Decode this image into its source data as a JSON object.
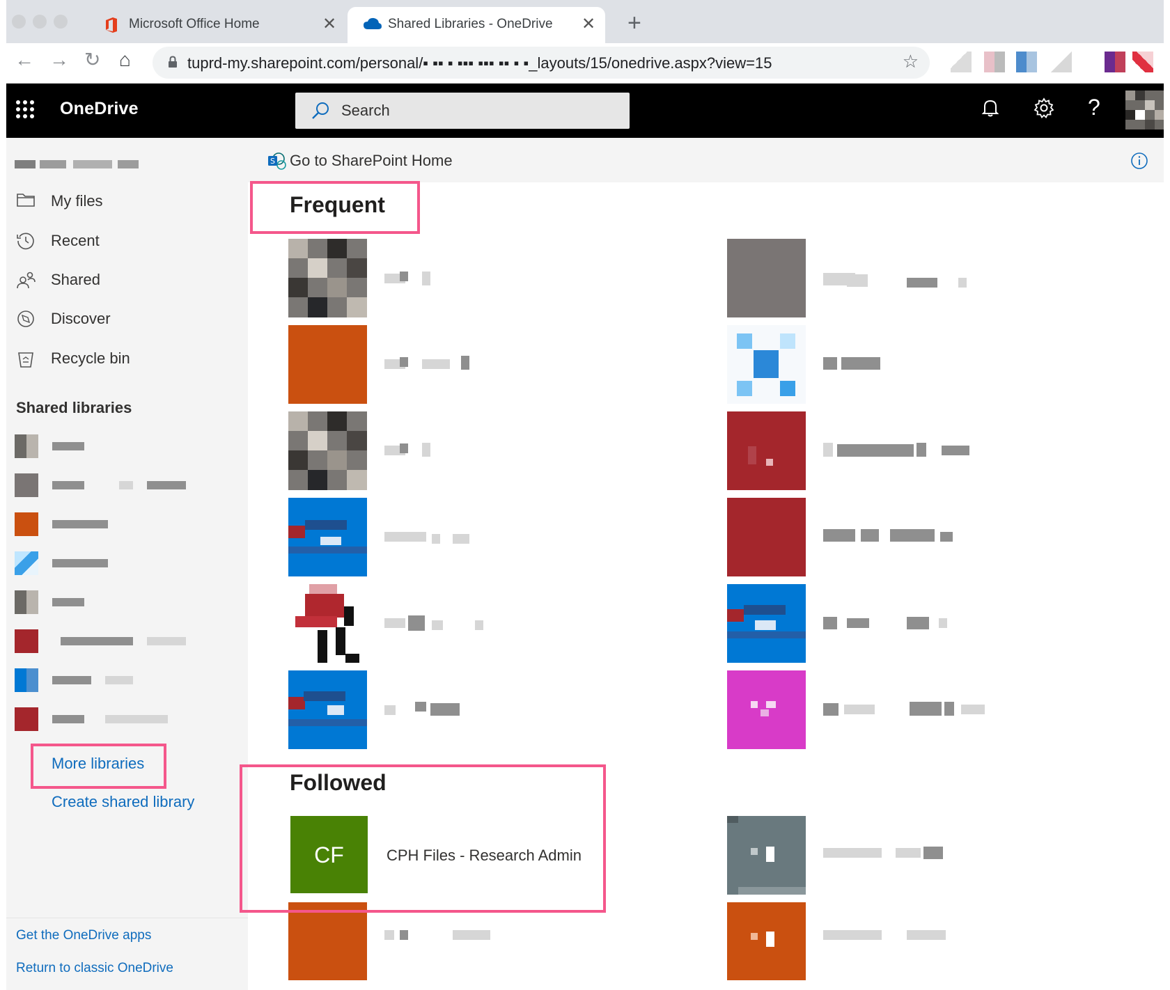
{
  "browser": {
    "tabs": [
      {
        "label": "Microsoft Office Home",
        "active": false,
        "icon": "office-icon"
      },
      {
        "label": "Shared Libraries - OneDrive",
        "active": true,
        "icon": "onedrive-cloud-icon"
      }
    ],
    "close_glyph": "✕",
    "new_tab_glyph": "+",
    "url": "tuprd-my.sharepoint.com/personal/▪ ▪▪ ▪ ▪▪▪ ▪▪▪ ▪▪ ▪ ▪_layouts/15/onedrive.aspx?view=15",
    "back_glyph": "←",
    "forward_glyph": "→",
    "reload_glyph": "↻",
    "home_glyph": "⌂",
    "star_glyph": "☆"
  },
  "header": {
    "app_name": "OneDrive",
    "search_placeholder": "Search",
    "help_glyph": "?"
  },
  "nav": {
    "items": [
      {
        "label": "My files",
        "icon": "folder-icon"
      },
      {
        "label": "Recent",
        "icon": "recent-clock-icon"
      },
      {
        "label": "Shared",
        "icon": "shared-people-icon"
      },
      {
        "label": "Discover",
        "icon": "discover-compass-icon"
      },
      {
        "label": "Recycle bin",
        "icon": "recycle-bin-icon"
      }
    ],
    "shared_libraries_title": "Shared libraries",
    "more_libraries": "More libraries",
    "create_shared_library": "Create shared library",
    "get_apps": "Get the OneDrive apps",
    "return_classic": "Return to classic OneDrive"
  },
  "main": {
    "go_to_sharepoint": "Go to SharePoint Home",
    "frequent_heading": "Frequent",
    "followed_heading": "Followed",
    "followed_item": {
      "initials": "CF",
      "name": "CPH Files - Research Admin",
      "color": "#498205"
    }
  },
  "colors": {
    "accent_link": "#0f6cbd",
    "highlight_box": "#f4578b",
    "header_bg": "#000000",
    "orange_tile": "#ca5010",
    "red_tile": "#a4262c",
    "blue_tile": "#0078d4",
    "magenta_tile": "#d83bc8",
    "gray_tile": "#7a7574",
    "slate_tile": "#69797e"
  }
}
